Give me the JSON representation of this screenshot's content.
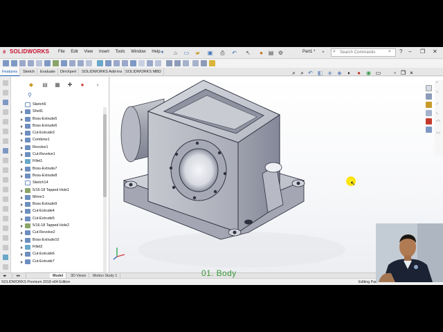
{
  "app": {
    "logo_text": "SOLIDWORKS",
    "menu": [
      "File",
      "Edit",
      "View",
      "Insert",
      "Tools",
      "Window",
      "Help"
    ],
    "document_name": "Part1 *",
    "search_placeholder": "Search Commands"
  },
  "command_tabs": [
    "Features",
    "Sketch",
    "Evaluate",
    "DimXpert",
    "SOLIDWORKS Add-Ins",
    "SOLIDWORKS MBD"
  ],
  "active_command_tab": "Features",
  "feature_tree": [
    {
      "label": "Sketch6",
      "kind": "sketch"
    },
    {
      "label": "Shell1",
      "kind": "feature"
    },
    {
      "label": "Boss-Extrude5",
      "kind": "feature"
    },
    {
      "label": "Boss-Extrude6",
      "kind": "feature"
    },
    {
      "label": "Cut-Extrude3",
      "kind": "feature"
    },
    {
      "label": "Combine1",
      "kind": "feature"
    },
    {
      "label": "Revolve1",
      "kind": "feature"
    },
    {
      "label": "Cut-Revolve1",
      "kind": "feature"
    },
    {
      "label": "Fillet1",
      "kind": "fillet"
    },
    {
      "label": "Boss-Extrude7",
      "kind": "feature"
    },
    {
      "label": "Boss-Extrude8",
      "kind": "feature"
    },
    {
      "label": "Sketch14",
      "kind": "sketch"
    },
    {
      "label": "5/16-18 Tapped Hole1",
      "kind": "hole"
    },
    {
      "label": "Mirror1",
      "kind": "feature"
    },
    {
      "label": "Boss-Extrude9",
      "kind": "feature"
    },
    {
      "label": "Cut-Extrude4",
      "kind": "feature"
    },
    {
      "label": "Cut-Extrude5",
      "kind": "feature"
    },
    {
      "label": "5/16-18 Tapped Hole2",
      "kind": "hole"
    },
    {
      "label": "Cut-Revolve2",
      "kind": "feature"
    },
    {
      "label": "Boss-Extrude10",
      "kind": "feature"
    },
    {
      "label": "Fillet2",
      "kind": "fillet"
    },
    {
      "label": "Cut-Extrude6",
      "kind": "feature"
    },
    {
      "label": "Cut-Extrude7",
      "kind": "feature"
    }
  ],
  "bottom_tabs": [
    "Model",
    "3D Views",
    "Motion Study 1"
  ],
  "active_bottom_tab": "Model",
  "status": {
    "left": "SOLIDWORKS Premium 2018 x64 Edition",
    "right": "Editing Part"
  },
  "caption": "01. Body",
  "colors": {
    "brand_red": "#c8102e",
    "caption_green": "#3c9a3a",
    "model_gray": "#b9bcc4",
    "accent_blue": "#1a5fb4"
  }
}
